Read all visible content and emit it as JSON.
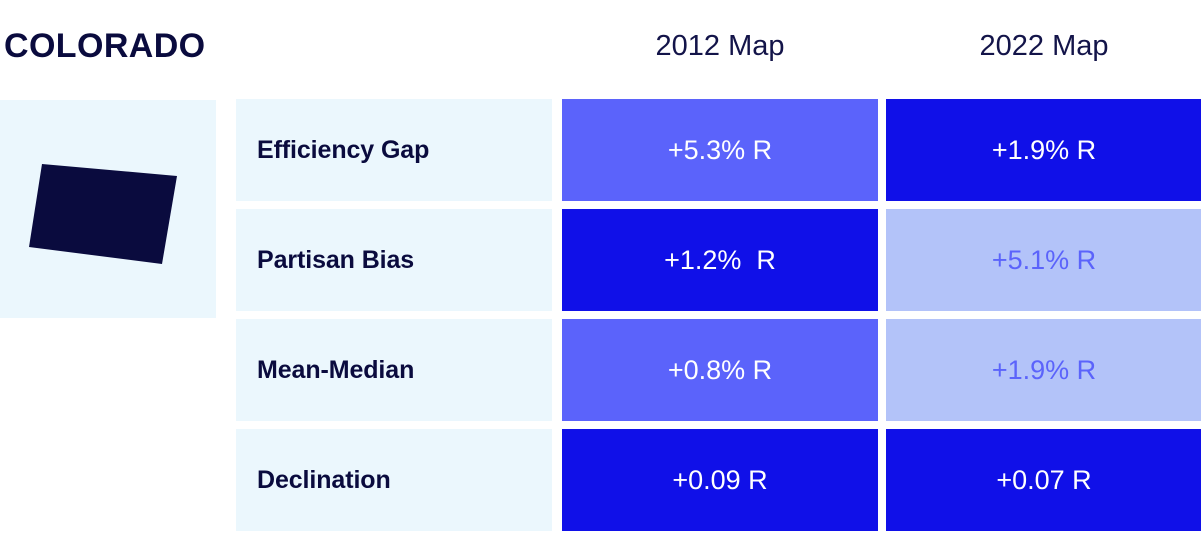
{
  "state": {
    "name": "COLORADO",
    "map_icon": "colorado-state-outline",
    "map_panel_bg": "#EBF7FD",
    "map_shape_color": "#0A0B3E"
  },
  "columns": [
    {
      "key": "map2012",
      "label": "2012 Map"
    },
    {
      "key": "map2022",
      "label": "2022 Map"
    }
  ],
  "palette": {
    "navy": "#0A0B3E",
    "label_bg": "#EBF7FD",
    "blue_medium": "#5B63FB",
    "blue_deep": "#1010E8",
    "blue_light": "#B3C3F9",
    "text_white": "#FFFFFF",
    "text_blue": "#5B63FB"
  },
  "rows": [
    {
      "label": "Efficiency Gap",
      "map2012": {
        "value": "+5.3% R",
        "bg": "#5B63FB",
        "fg": "#FFFFFF"
      },
      "map2022": {
        "value": "+1.9% R",
        "bg": "#1010E8",
        "fg": "#FFFFFF"
      }
    },
    {
      "label": "Partisan Bias",
      "map2012": {
        "value": "+1.2%  R",
        "bg": "#1010E8",
        "fg": "#FFFFFF"
      },
      "map2022": {
        "value": "+5.1% R",
        "bg": "#B3C3F9",
        "fg": "#5B63FB"
      }
    },
    {
      "label": "Mean-Median",
      "map2012": {
        "value": "+0.8% R",
        "bg": "#5B63FB",
        "fg": "#FFFFFF"
      },
      "map2022": {
        "value": "+1.9% R",
        "bg": "#B3C3F9",
        "fg": "#5B63FB"
      }
    },
    {
      "label": "Declination",
      "map2012": {
        "value": "+0.09 R",
        "bg": "#1010E8",
        "fg": "#FFFFFF"
      },
      "map2022": {
        "value": "+0.07 R",
        "bg": "#1010E8",
        "fg": "#FFFFFF"
      }
    }
  ]
}
